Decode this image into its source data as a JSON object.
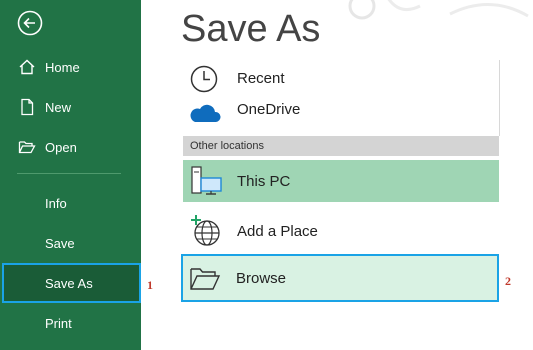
{
  "sidebar": {
    "items": [
      {
        "label": "Home"
      },
      {
        "label": "New"
      },
      {
        "label": "Open"
      },
      {
        "label": "Info"
      },
      {
        "label": "Save"
      },
      {
        "label": "Save As"
      },
      {
        "label": "Print"
      }
    ],
    "selected_index": 5,
    "callout": "1"
  },
  "main": {
    "title": "Save As",
    "recent_label": "Recent",
    "onedrive_label": "OneDrive",
    "other_locations_header": "Other locations",
    "this_pc_label": "This PC",
    "add_place_label": "Add a Place",
    "browse_label": "Browse",
    "browse_callout": "2"
  },
  "colors": {
    "sidebar_bg": "#217346",
    "selected_bg": "#1a5c37",
    "highlight_border": "#1aa3e6",
    "this_pc_bg": "#9fd5b4",
    "browse_bg": "#d9f2e3",
    "callout": "#c0392b"
  },
  "icons": {
    "back": "back-arrow-icon",
    "home": "home-icon",
    "new": "new-document-icon",
    "open": "folder-open-icon",
    "recent": "clock-icon",
    "onedrive": "cloud-icon",
    "this_pc": "computer-icon",
    "add_place": "globe-plus-icon",
    "browse": "folder-icon"
  }
}
